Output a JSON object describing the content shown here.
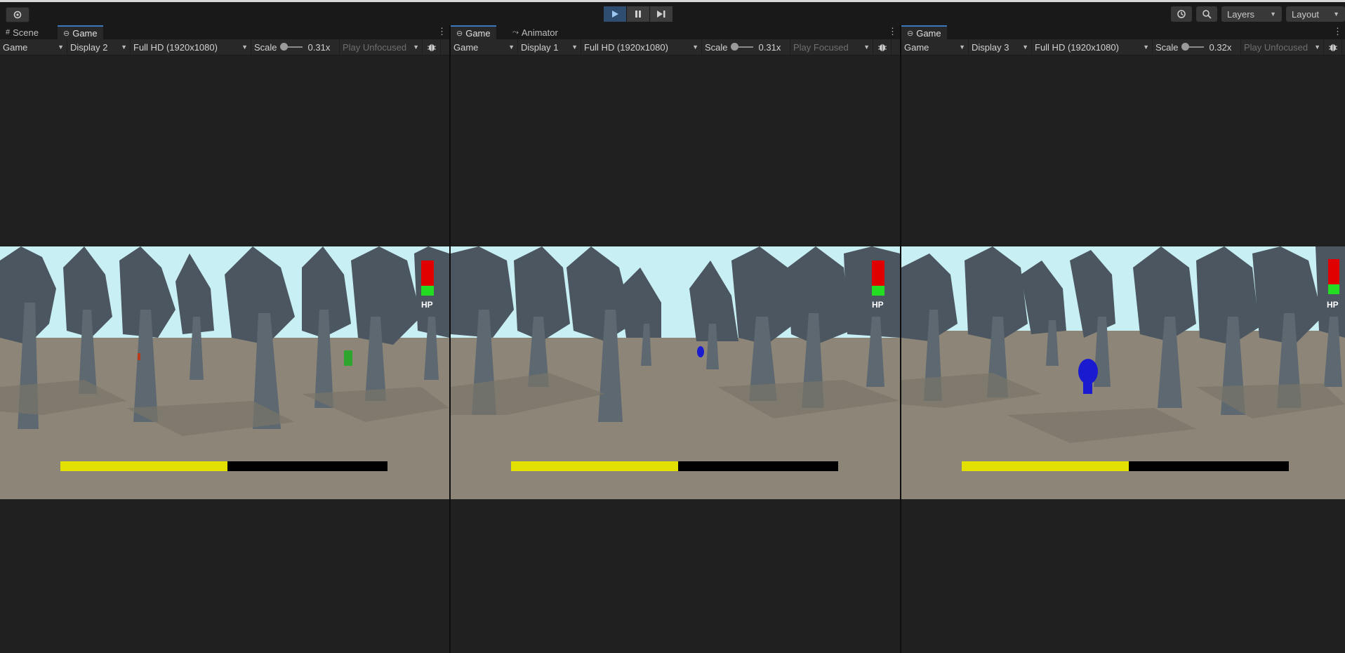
{
  "toolbar": {
    "settings_icon": "gear-icon",
    "play_icon": "play-icon",
    "pause_icon": "pause-icon",
    "step_icon": "step-icon",
    "history_icon": "history-icon",
    "search_icon": "search-icon",
    "layers_label": "Layers",
    "layout_label": "Layout"
  },
  "panels": [
    {
      "tabs": [
        {
          "label": "Scene",
          "icon": "grid-icon",
          "active": false
        },
        {
          "label": "Game",
          "icon": "gamepad-icon",
          "active": true
        }
      ],
      "view_mode": "Game",
      "display": "Display 2",
      "resolution": "Full HD (1920x1080)",
      "scale_label": "Scale",
      "scale_value": "0.31x",
      "play_mode": "Play Unfocused",
      "hp_label": "HP",
      "progress_fraction": 0.51
    },
    {
      "tabs": [
        {
          "label": "Game",
          "icon": "gamepad-icon",
          "active": true
        },
        {
          "label": "Animator",
          "icon": "animator-icon",
          "active": false
        }
      ],
      "view_mode": "Game",
      "display": "Display 1",
      "resolution": "Full HD (1920x1080)",
      "scale_label": "Scale",
      "scale_value": "0.31x",
      "play_mode": "Play Focused",
      "hp_label": "HP",
      "progress_fraction": 0.51
    },
    {
      "tabs": [
        {
          "label": "Game",
          "icon": "gamepad-icon",
          "active": true
        }
      ],
      "view_mode": "Game",
      "display": "Display 3",
      "resolution": "Full HD (1920x1080)",
      "scale_label": "Scale",
      "scale_value": "0.32x",
      "play_mode": "Play Unfocused",
      "hp_label": "HP",
      "progress_fraction": 0.51
    }
  ],
  "colors": {
    "sky": "#c8f0f4",
    "ground": "#8d8678",
    "tree": "#4e5962",
    "trunk": "#5f6a73",
    "progress_fill": "#e3e000",
    "progress_track": "#000000",
    "hp_red": "#e00000",
    "hp_green": "#22dd22",
    "accent": "#3a79bb"
  }
}
